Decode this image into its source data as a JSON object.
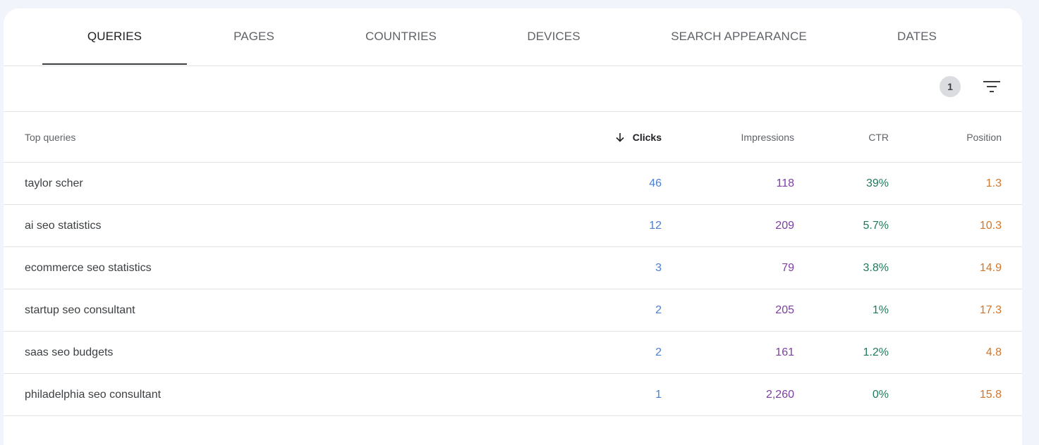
{
  "tabs": [
    {
      "label": "QUERIES",
      "active": true
    },
    {
      "label": "PAGES",
      "active": false
    },
    {
      "label": "COUNTRIES",
      "active": false
    },
    {
      "label": "DEVICES",
      "active": false
    },
    {
      "label": "SEARCH APPEARANCE",
      "active": false
    },
    {
      "label": "DATES",
      "active": false
    }
  ],
  "toolbar": {
    "filter_count": "1",
    "filter_icon": "filter-list-icon"
  },
  "table": {
    "headers": {
      "query": "Top queries",
      "clicks": "Clicks",
      "impressions": "Impressions",
      "ctr": "CTR",
      "position": "Position"
    },
    "sort_icon": "arrow-down-icon",
    "rows": [
      {
        "query": "taylor scher",
        "clicks": "46",
        "impressions": "118",
        "ctr": "39%",
        "position": "1.3"
      },
      {
        "query": "ai seo statistics",
        "clicks": "12",
        "impressions": "209",
        "ctr": "5.7%",
        "position": "10.3"
      },
      {
        "query": "ecommerce seo statistics",
        "clicks": "3",
        "impressions": "79",
        "ctr": "3.8%",
        "position": "14.9"
      },
      {
        "query": "startup seo consultant",
        "clicks": "2",
        "impressions": "205",
        "ctr": "1%",
        "position": "17.3"
      },
      {
        "query": "saas seo budgets",
        "clicks": "2",
        "impressions": "161",
        "ctr": "1.2%",
        "position": "4.8"
      },
      {
        "query": "philadelphia seo consultant",
        "clicks": "1",
        "impressions": "2,260",
        "ctr": "0%",
        "position": "15.8"
      }
    ]
  },
  "colors": {
    "clicks": "#4a7fd1",
    "impressions": "#7b3fa0",
    "ctr": "#1f7a5c",
    "position": "#d2762a"
  }
}
